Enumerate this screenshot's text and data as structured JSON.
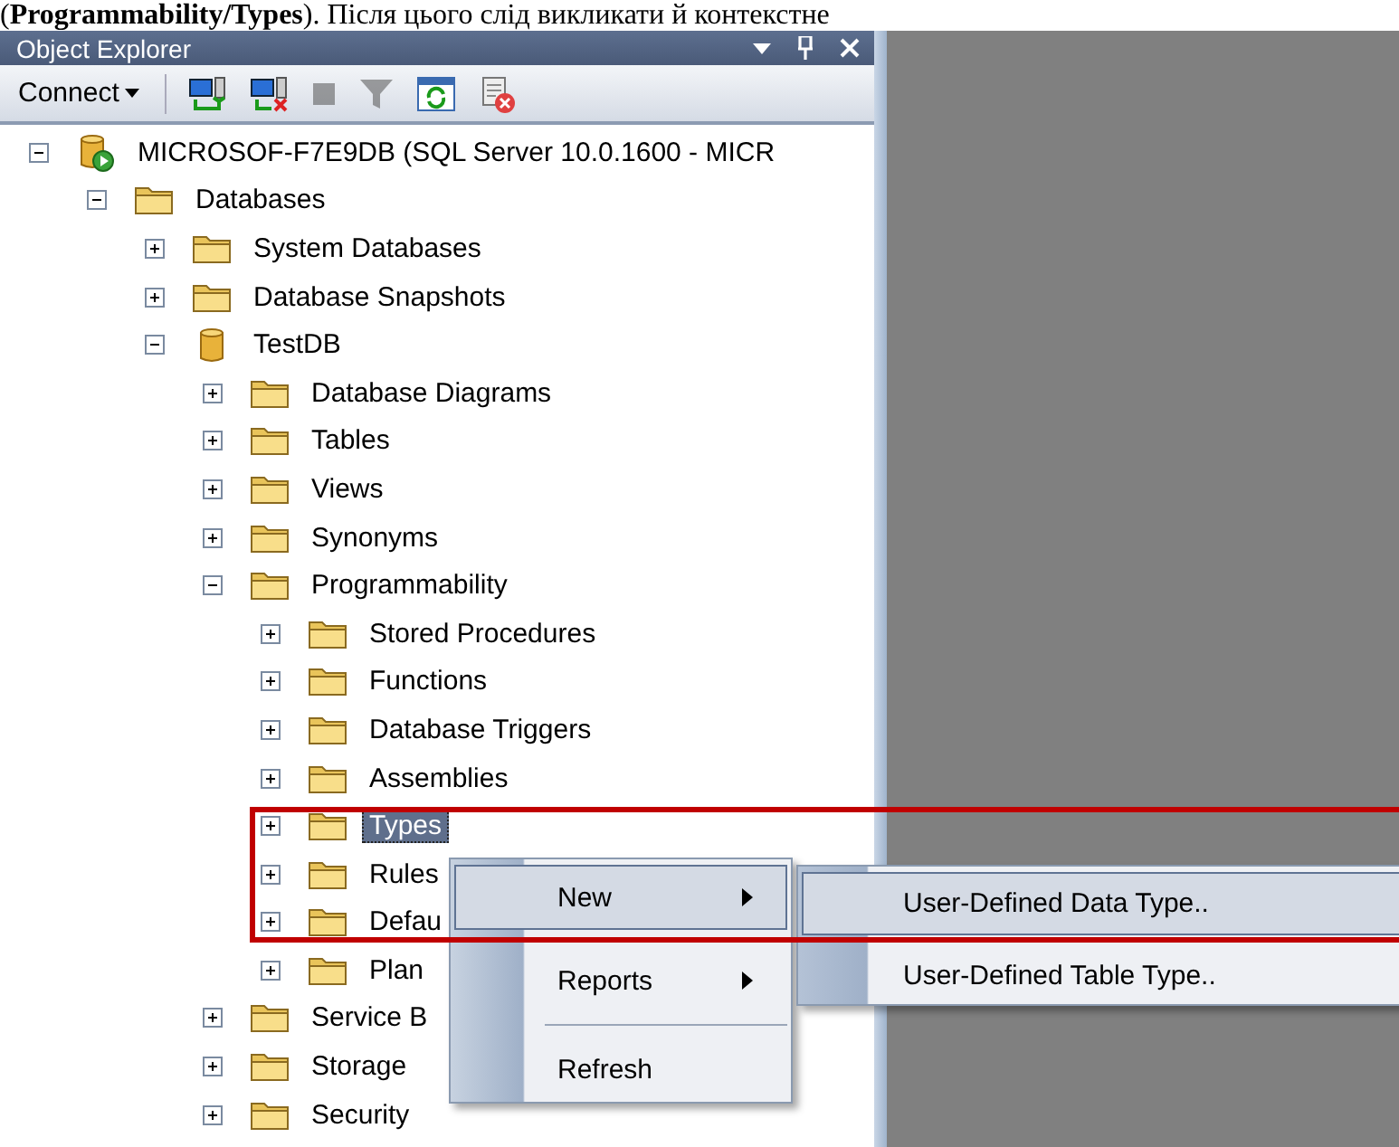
{
  "header_text": "(**Programmability/Types**). Після цього слід викликати й контекстне",
  "window": {
    "title": "Object Explorer"
  },
  "toolbar": {
    "connect": "Connect",
    "buttons": [
      {
        "kind": "connect",
        "disabled": false
      },
      {
        "kind": "disconnect",
        "disabled": false
      },
      {
        "kind": "stop",
        "disabled": true
      },
      {
        "kind": "filter",
        "disabled": true
      },
      {
        "kind": "refresh",
        "disabled": false
      },
      {
        "kind": "cancel",
        "disabled": false
      }
    ]
  },
  "tree": [
    {
      "label": "MICROSOF-F7E9DB (SQL Server 10.0.1600 - MICR",
      "kind": "server",
      "expanded": true,
      "selected": false,
      "children": [
        {
          "label": "Databases",
          "kind": "folder",
          "expanded": true,
          "selected": false,
          "children": [
            {
              "label": "System Databases",
              "kind": "folder",
              "expanded": false,
              "selected": false
            },
            {
              "label": "Database Snapshots",
              "kind": "folder",
              "expanded": false,
              "selected": false
            },
            {
              "label": "TestDB",
              "kind": "database",
              "expanded": true,
              "selected": false,
              "children": [
                {
                  "label": "Database Diagrams",
                  "kind": "folder",
                  "expanded": false,
                  "selected": false
                },
                {
                  "label": "Tables",
                  "kind": "folder",
                  "expanded": false,
                  "selected": false
                },
                {
                  "label": "Views",
                  "kind": "folder",
                  "expanded": false,
                  "selected": false
                },
                {
                  "label": "Synonyms",
                  "kind": "folder",
                  "expanded": false,
                  "selected": false
                },
                {
                  "label": "Programmability",
                  "kind": "folder",
                  "expanded": true,
                  "selected": false,
                  "children": [
                    {
                      "label": "Stored Procedures",
                      "kind": "folder",
                      "expanded": false,
                      "selected": false
                    },
                    {
                      "label": "Functions",
                      "kind": "folder",
                      "expanded": false,
                      "selected": false
                    },
                    {
                      "label": "Database Triggers",
                      "kind": "folder",
                      "expanded": false,
                      "selected": false
                    },
                    {
                      "label": "Assemblies",
                      "kind": "folder",
                      "expanded": false,
                      "selected": false
                    },
                    {
                      "label": "Types",
                      "kind": "folder",
                      "expanded": false,
                      "selected": true
                    },
                    {
                      "label": "Rules",
                      "kind": "folder",
                      "expanded": false,
                      "selected": false
                    },
                    {
                      "label": "Defau",
                      "kind": "folder",
                      "expanded": false,
                      "selected": false
                    },
                    {
                      "label": "Plan",
                      "kind": "folder",
                      "expanded": false,
                      "selected": false
                    }
                  ]
                },
                {
                  "label": "Service B",
                  "kind": "folder",
                  "expanded": false,
                  "selected": false
                },
                {
                  "label": "Storage",
                  "kind": "folder",
                  "expanded": false,
                  "selected": false
                },
                {
                  "label": "Security",
                  "kind": "folder",
                  "expanded": false,
                  "selected": false
                }
              ]
            }
          ]
        }
      ]
    }
  ],
  "context_menu": {
    "items": [
      {
        "kind": "submenu",
        "label": "New",
        "selected": true
      },
      {
        "kind": "submenu",
        "label": "Reports",
        "selected": false
      },
      {
        "kind": "separator"
      },
      {
        "kind": "command",
        "label": "Refresh",
        "selected": false
      }
    ]
  },
  "submenu": {
    "items": [
      {
        "label": "User-Defined Data Type..",
        "selected": true
      },
      {
        "label": "User-Defined Table Type..",
        "selected": false
      }
    ]
  }
}
